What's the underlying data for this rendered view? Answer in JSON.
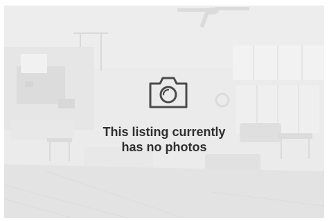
{
  "placeholder": {
    "message_line1": "This listing currently",
    "message_line2": "has no photos",
    "icon": "camera-icon",
    "background_scene": "blurred-living-room-photo"
  },
  "colors": {
    "overlay": "#e9e9e9",
    "icon_stroke": "#4a4a4a",
    "text": "#2e2e2e"
  }
}
